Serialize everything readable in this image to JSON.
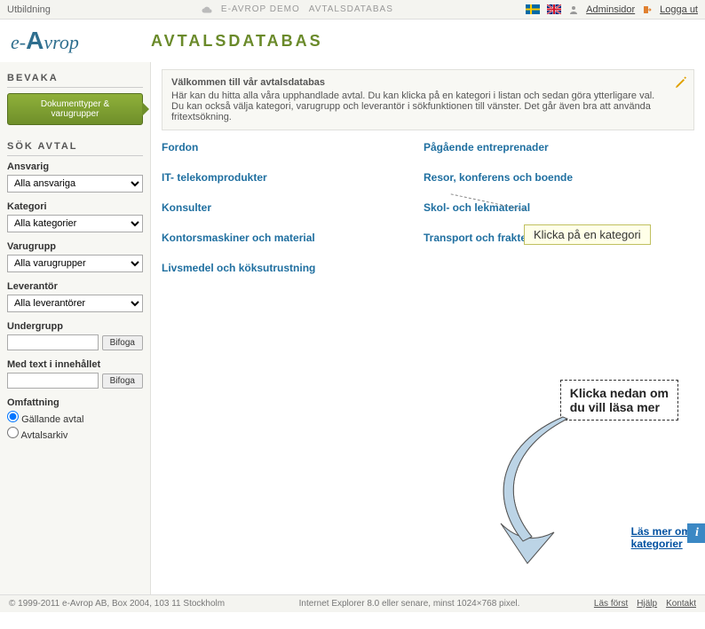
{
  "top": {
    "left": "Utbildning",
    "crumb1": "E-AVROP DEMO",
    "crumb2": "AVTALSDATABAS",
    "adminsidor": "Adminsidor",
    "logout": "Logga ut"
  },
  "logo_pre": "e-",
  "logo_mid": "A",
  "logo_post": "vrop",
  "page_title": "AVTALSDATABAS",
  "left": {
    "bevaka": "BEVAKA",
    "docbtn_l1": "Dokumenttyper &",
    "docbtn_l2": "varugrupper",
    "sok": "SÖK AVTAL",
    "ansvarig_label": "Ansvarig",
    "ansvarig_value": "Alla ansvariga",
    "kategori_label": "Kategori",
    "kategori_value": "Alla kategorier",
    "varugrupp_label": "Varugrupp",
    "varugrupp_value": "Alla varugrupper",
    "leverantor_label": "Leverantör",
    "leverantor_value": "Alla leverantörer",
    "undergrupp_label": "Undergrupp",
    "undergrupp_value": "",
    "fritext_label": "Med text i innehållet",
    "fritext_value": "",
    "bifoga": "Bifoga",
    "omfattning_label": "Omfattning",
    "radio1": "Gällande avtal",
    "radio2": "Avtalsarkiv"
  },
  "welcome": {
    "title": "Välkommen till vår avtalsdatabas",
    "body": "Här kan du hitta alla våra upphandlade avtal. Du kan klicka på en kategori i listan och sedan göra ytterligare val. Du kan också välja kategori, varugrupp och leverantör i sökfunktionen till vänster. Det går även bra att använda fritextsökning."
  },
  "categories_left": [
    "Fordon",
    "IT- telekomprodukter",
    "Konsulter",
    "Kontorsmaskiner och material",
    "Livsmedel och köksutrustning"
  ],
  "categories_right": [
    "Pågående entreprenader",
    "Resor, konferens och boende",
    "Skol- och lekmaterial",
    "Transport och frakter"
  ],
  "callout1": "Klicka på en kategori",
  "callout2_l1": "Klicka nedan om",
  "callout2_l2": "du vill läsa mer",
  "readmore_l1": "Läs mer om",
  "readmore_l2": "kategorier",
  "footer": {
    "left": "© 1999-2011 e-Avrop AB, Box 2004, 103 11 Stockholm",
    "mid": "Internet Explorer 8.0 eller senare, minst 1024×768 pixel.",
    "lasforst": "Läs först",
    "hjalp": "Hjälp",
    "kontakt": "Kontakt"
  }
}
